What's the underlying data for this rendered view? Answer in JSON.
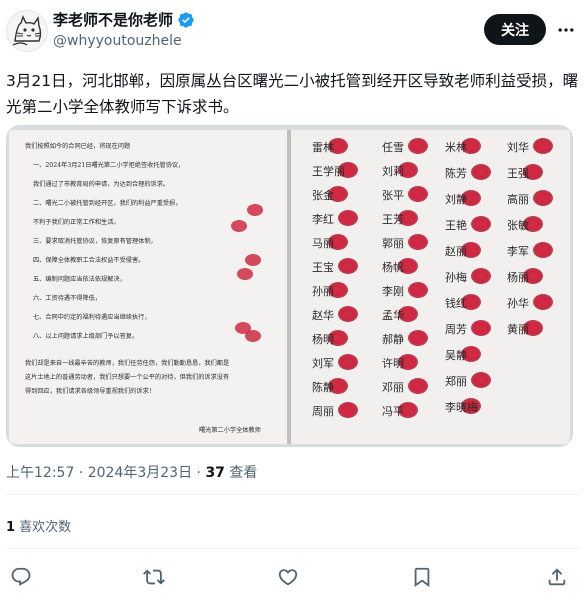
{
  "author": {
    "display_name": "李老师不是你老师",
    "handle": "@whyyoutouzhele",
    "verified_icon": "verified-badge-icon",
    "avatar_icon": "cat-sketch-avatar"
  },
  "follow_button_label": "关注",
  "more_icon": "more-options-icon",
  "tweet": {
    "text": "3月21日，河北邯郸，因原属丛台区曙光二小被托管到经开区导致老师利益受损，曙光第二小学全体教师写下诉求书。"
  },
  "media": {
    "left_page": {
      "lines": [
        "我们按照如今的合同已经，将现在问题",
        "一、2024年3月21日曙光第二小学拒绝签收托管协议，",
        "我们通过了市教育局的申请，为达到合理的诉求。",
        "二、曙光二小被托管到经开区，我们的利益严重受损，",
        "不利于我们的正常工作和生活。",
        "三、要求取消托管协议，恢复原有管理体制，",
        "四、保障全体教职工合法权益不受侵害。",
        "五、编制问题应当依法依规解决，",
        "六、工资待遇不得降低，",
        "七、合同中约定的福利待遇应当继续执行，",
        "八、以上问题请求上级部门予以答复。"
      ],
      "closing": [
        "我们却是来自一线最辛苦的教师，我们任劳任怨，我们勤勤恳恳，我们都是",
        "这片土地上的普通劳动者，我们只想要一个公平的对待，但我们的诉求没有",
        "得到回应，我们请求各级领导重视我们的诉求！"
      ],
      "signature": "曙光第二小学全体教师"
    },
    "right_page": {
      "names_col1": [
        "雷林",
        "王学丽",
        "张金",
        "李红",
        "马丽",
        "王宝",
        "孙丽",
        "赵华",
        "杨明",
        "刘军",
        "陈静",
        "周丽"
      ],
      "names_col2": [
        "任雪",
        "刘莉",
        "张平",
        "王芳",
        "郭丽",
        "杨帆",
        "李刚",
        "孟华",
        "郝静",
        "许明",
        "邓丽",
        "冯平"
      ],
      "names_col3": [
        "米林",
        "陈芳",
        "刘静",
        "王艳",
        "赵丽",
        "孙梅",
        "钱红",
        "周芳",
        "吴静",
        "郑丽",
        "李晓梅"
      ],
      "names_col4": [
        "刘华",
        "王强",
        "高丽",
        "张敏",
        "李军",
        "杨丽",
        "孙华",
        "黄丽"
      ]
    }
  },
  "meta": {
    "time": "上午12:57",
    "separator": " · ",
    "date": "2024年3月23日",
    "views_count": "37",
    "views_label": " 查看"
  },
  "engagement": {
    "likes_count": "1",
    "likes_label": " 喜欢次数"
  },
  "actions": {
    "reply_icon": "reply-icon",
    "retweet_icon": "retweet-icon",
    "like_icon": "heart-icon",
    "bookmark_icon": "bookmark-icon",
    "share_icon": "share-icon"
  },
  "colors": {
    "text": "#0f1419",
    "secondary": "#536471",
    "verified": "#1d9bf0",
    "fingerprint": "#c8102e",
    "divider": "#eff3f4"
  }
}
